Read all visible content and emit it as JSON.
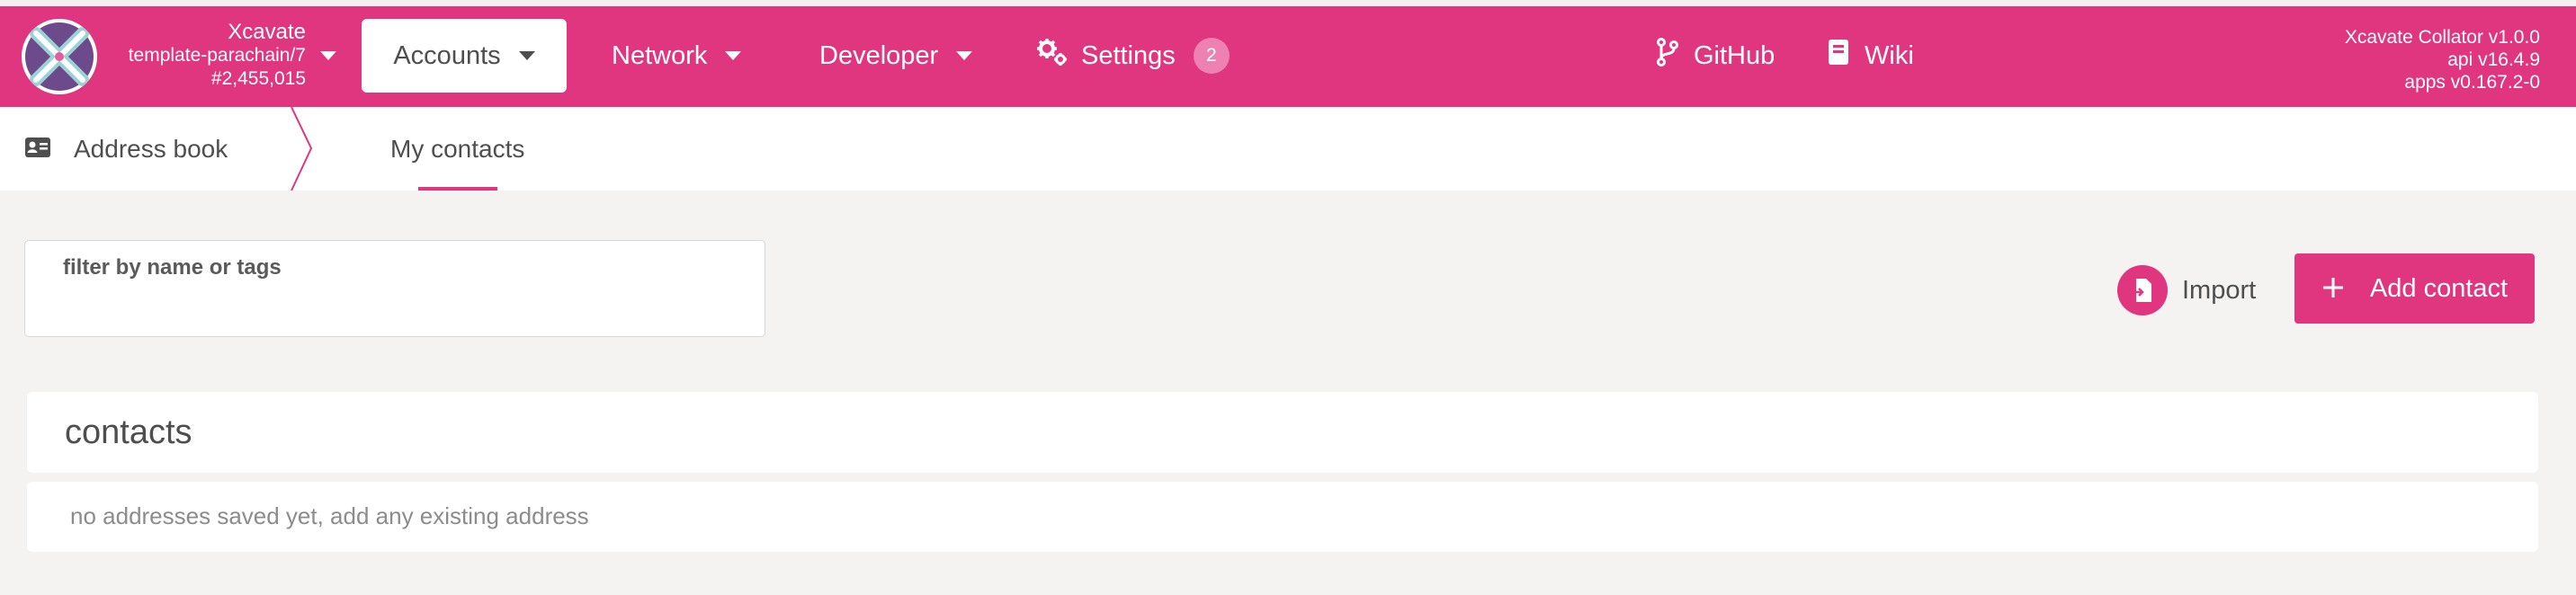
{
  "colors": {
    "accent": "#e0357f",
    "badge": "#ed82b2",
    "background": "#f4f3f1"
  },
  "chain": {
    "name": "Xcavate",
    "spec": "template-parachain/7",
    "block": "#2,455,015"
  },
  "nav": {
    "accounts": "Accounts",
    "network": "Network",
    "developer": "Developer",
    "settings": "Settings",
    "settings_badge": "2",
    "github": "GitHub",
    "wiki": "Wiki"
  },
  "versions": {
    "collator": "Xcavate Collator v1.0.0",
    "api": "api v16.4.9",
    "apps": "apps v0.167.2-0"
  },
  "tabs": {
    "address_book": "Address book",
    "my_contacts": "My contacts"
  },
  "filter": {
    "label": "filter by name or tags",
    "value": ""
  },
  "actions": {
    "import": "Import",
    "add_contact": "Add contact"
  },
  "contacts": {
    "title": "contacts",
    "empty": "no addresses saved yet, add any existing address"
  }
}
